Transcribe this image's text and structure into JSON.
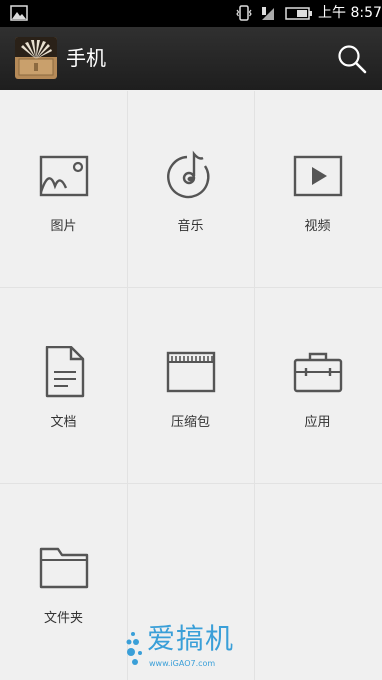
{
  "status_bar": {
    "time": "上午 8:57",
    "icons": [
      "image-thumbnail-icon",
      "vibrate-icon",
      "signal-icon",
      "battery-icon"
    ]
  },
  "app_bar": {
    "title": "手机",
    "app_icon": "file-manager-app-icon",
    "search_icon": "search-icon"
  },
  "categories": [
    {
      "label": "图片",
      "icon": "image-icon"
    },
    {
      "label": "音乐",
      "icon": "music-icon"
    },
    {
      "label": "视频",
      "icon": "video-icon"
    },
    {
      "label": "文档",
      "icon": "document-icon"
    },
    {
      "label": "压缩包",
      "icon": "archive-icon"
    },
    {
      "label": "应用",
      "icon": "app-briefcase-icon"
    },
    {
      "label": "文件夹",
      "icon": "folder-icon"
    }
  ],
  "watermark": {
    "brand": "爱搞机",
    "url": "www.iGAO7.com"
  },
  "colors": {
    "status_bar_bg": "#000000",
    "app_bar_bg": "#282828",
    "content_bg": "#f0f0f0",
    "icon_stroke": "#555555",
    "watermark": "#3a9fd8"
  }
}
